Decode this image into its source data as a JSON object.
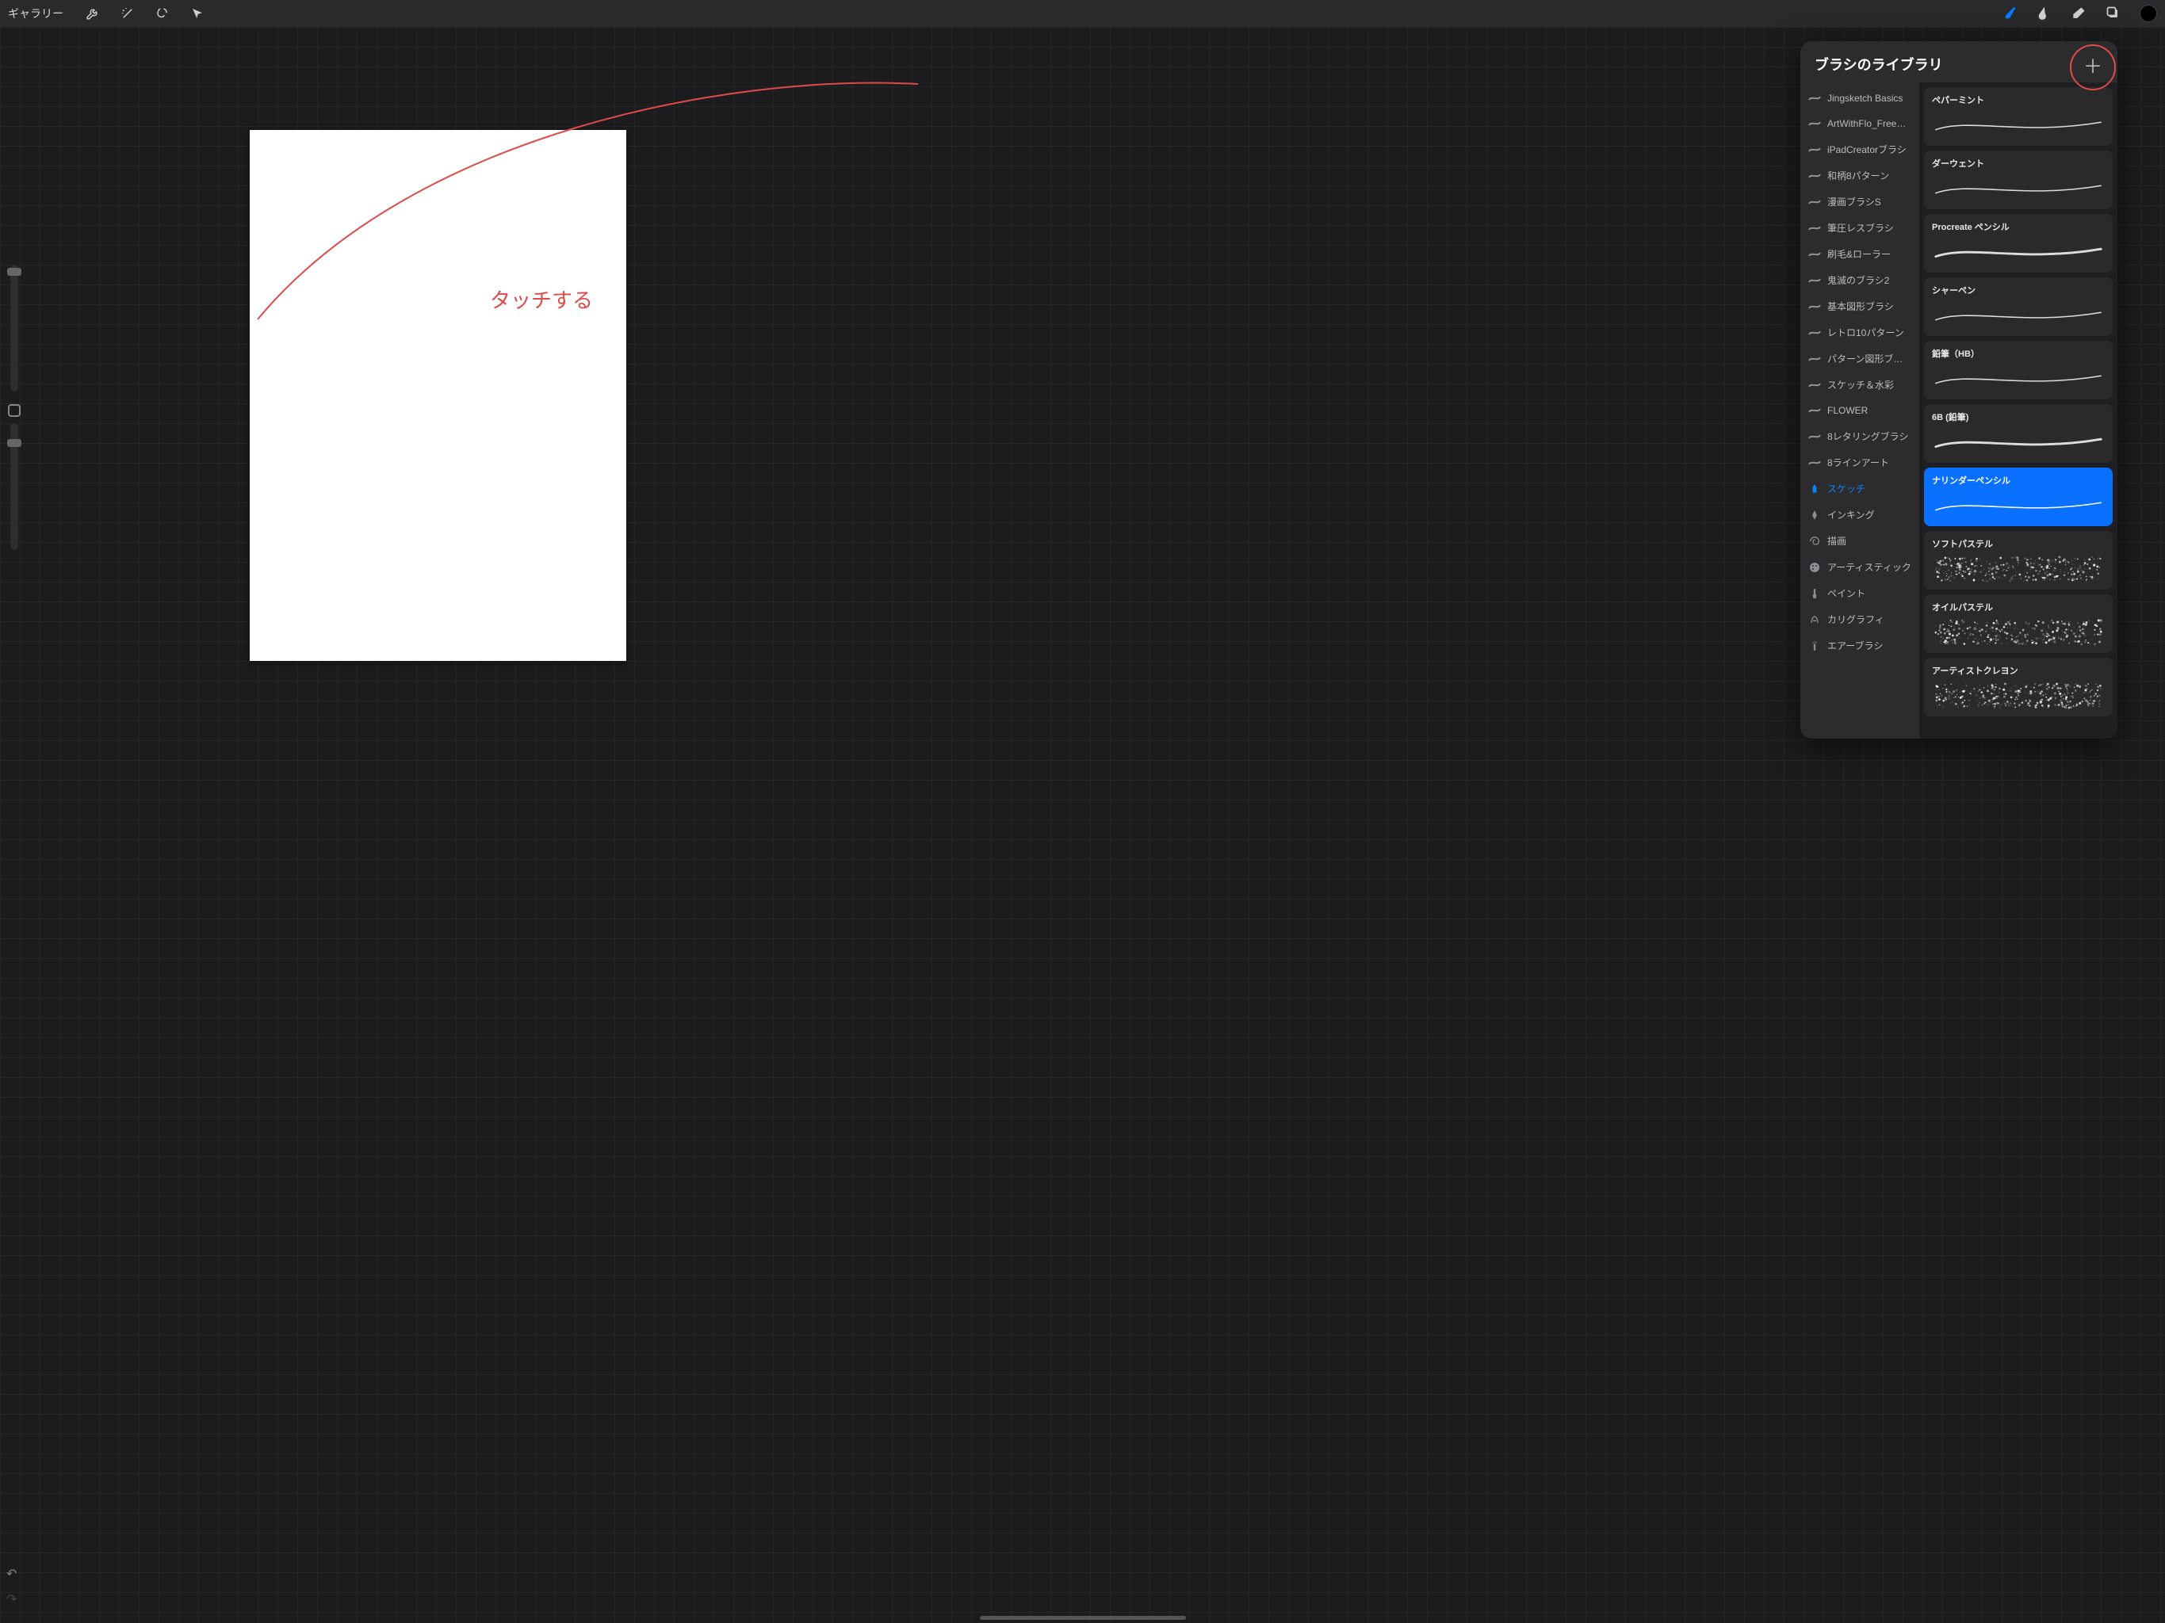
{
  "topbar": {
    "gallery_label": "ギャラリー"
  },
  "annotation": {
    "text": "タッチする"
  },
  "brush_panel": {
    "title": "ブラシのライブラリ",
    "sets": [
      {
        "label": "Jingsketch Basics",
        "icon": "stroke"
      },
      {
        "label": "ArtWithFlo_FreePalm...",
        "icon": "stroke"
      },
      {
        "label": "iPadCreatorブラシ",
        "icon": "stroke"
      },
      {
        "label": "和柄8パターン",
        "icon": "stroke"
      },
      {
        "label": "漫画ブラシS",
        "icon": "stroke"
      },
      {
        "label": "筆圧レスブラシ",
        "icon": "stroke"
      },
      {
        "label": "刷毛&ローラー",
        "icon": "stroke"
      },
      {
        "label": "鬼滅のブラシ2",
        "icon": "stroke"
      },
      {
        "label": "基本図形ブラシ",
        "icon": "stroke"
      },
      {
        "label": "レトロ10パターン",
        "icon": "stroke"
      },
      {
        "label": "パターン図形ブラシ",
        "icon": "stroke"
      },
      {
        "label": "スケッチ＆水彩",
        "icon": "stroke"
      },
      {
        "label": "FLOWER",
        "icon": "stroke"
      },
      {
        "label": "8レタリングブラシ",
        "icon": "stroke"
      },
      {
        "label": "8ラインアート",
        "icon": "stroke"
      },
      {
        "label": "スケッチ",
        "icon": "pencil",
        "selected": true
      },
      {
        "label": "インキング",
        "icon": "nib"
      },
      {
        "label": "描画",
        "icon": "swirl"
      },
      {
        "label": "アーティスティック",
        "icon": "palette"
      },
      {
        "label": "ペイント",
        "icon": "brush"
      },
      {
        "label": "カリグラフィ",
        "icon": "calligraphy"
      },
      {
        "label": "エアーブラシ",
        "icon": "spray"
      }
    ],
    "brushes": [
      {
        "name": "ペパーミント",
        "variant": "thin"
      },
      {
        "name": "ダーウェント",
        "variant": "thin"
      },
      {
        "name": "Procreate ペンシル",
        "variant": "medium"
      },
      {
        "name": "シャーペン",
        "variant": "thin"
      },
      {
        "name": "鉛筆（HB）",
        "variant": "thin"
      },
      {
        "name": "6B (鉛筆)",
        "variant": "medium"
      },
      {
        "name": "ナリンダーペンシル",
        "variant": "thin",
        "selected": true
      },
      {
        "name": "ソフトパステル",
        "variant": "texture"
      },
      {
        "name": "オイルパステル",
        "variant": "texture"
      },
      {
        "name": "アーティストクレヨン",
        "variant": "texture"
      }
    ]
  }
}
